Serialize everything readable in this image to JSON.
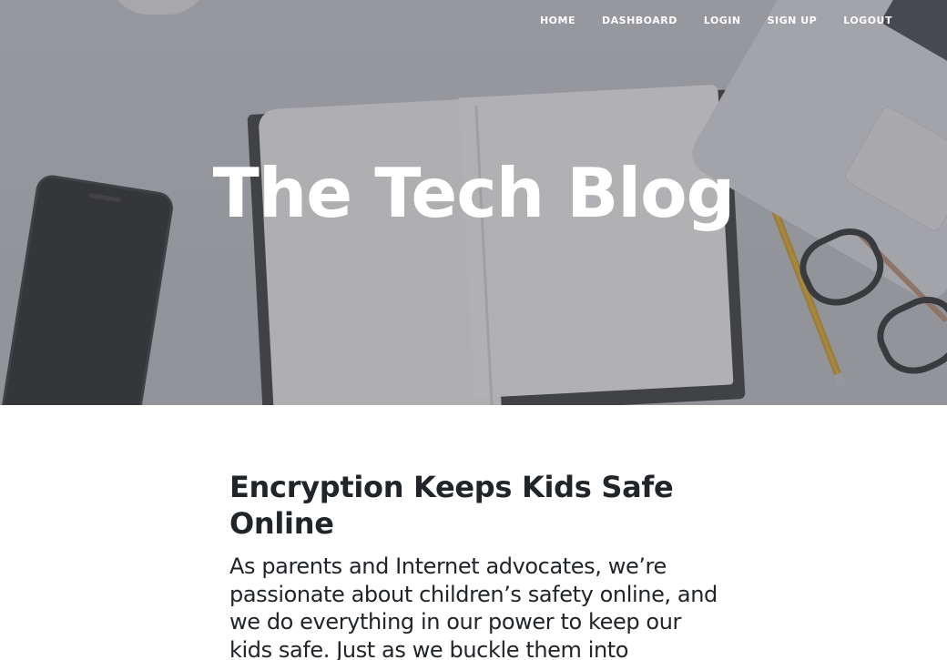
{
  "nav": {
    "items": [
      {
        "label": "HOME"
      },
      {
        "label": "DASHBOARD"
      },
      {
        "label": "LOGIN"
      },
      {
        "label": "SIGN UP"
      },
      {
        "label": "LOGOUT"
      }
    ]
  },
  "hero": {
    "title": "The Tech Blog"
  },
  "post": {
    "title": "Encryption Keeps Kids Safe Online",
    "body": "As parents and Internet advocates, we’re passionate about children’s safety online, and we do everything in our power to keep our kids safe. Just as we buckle them into seatbelts"
  },
  "colors": {
    "nav_text": "#ffffff",
    "hero_overlay": "#5a5c62",
    "text": "#212529",
    "background": "#ffffff"
  }
}
